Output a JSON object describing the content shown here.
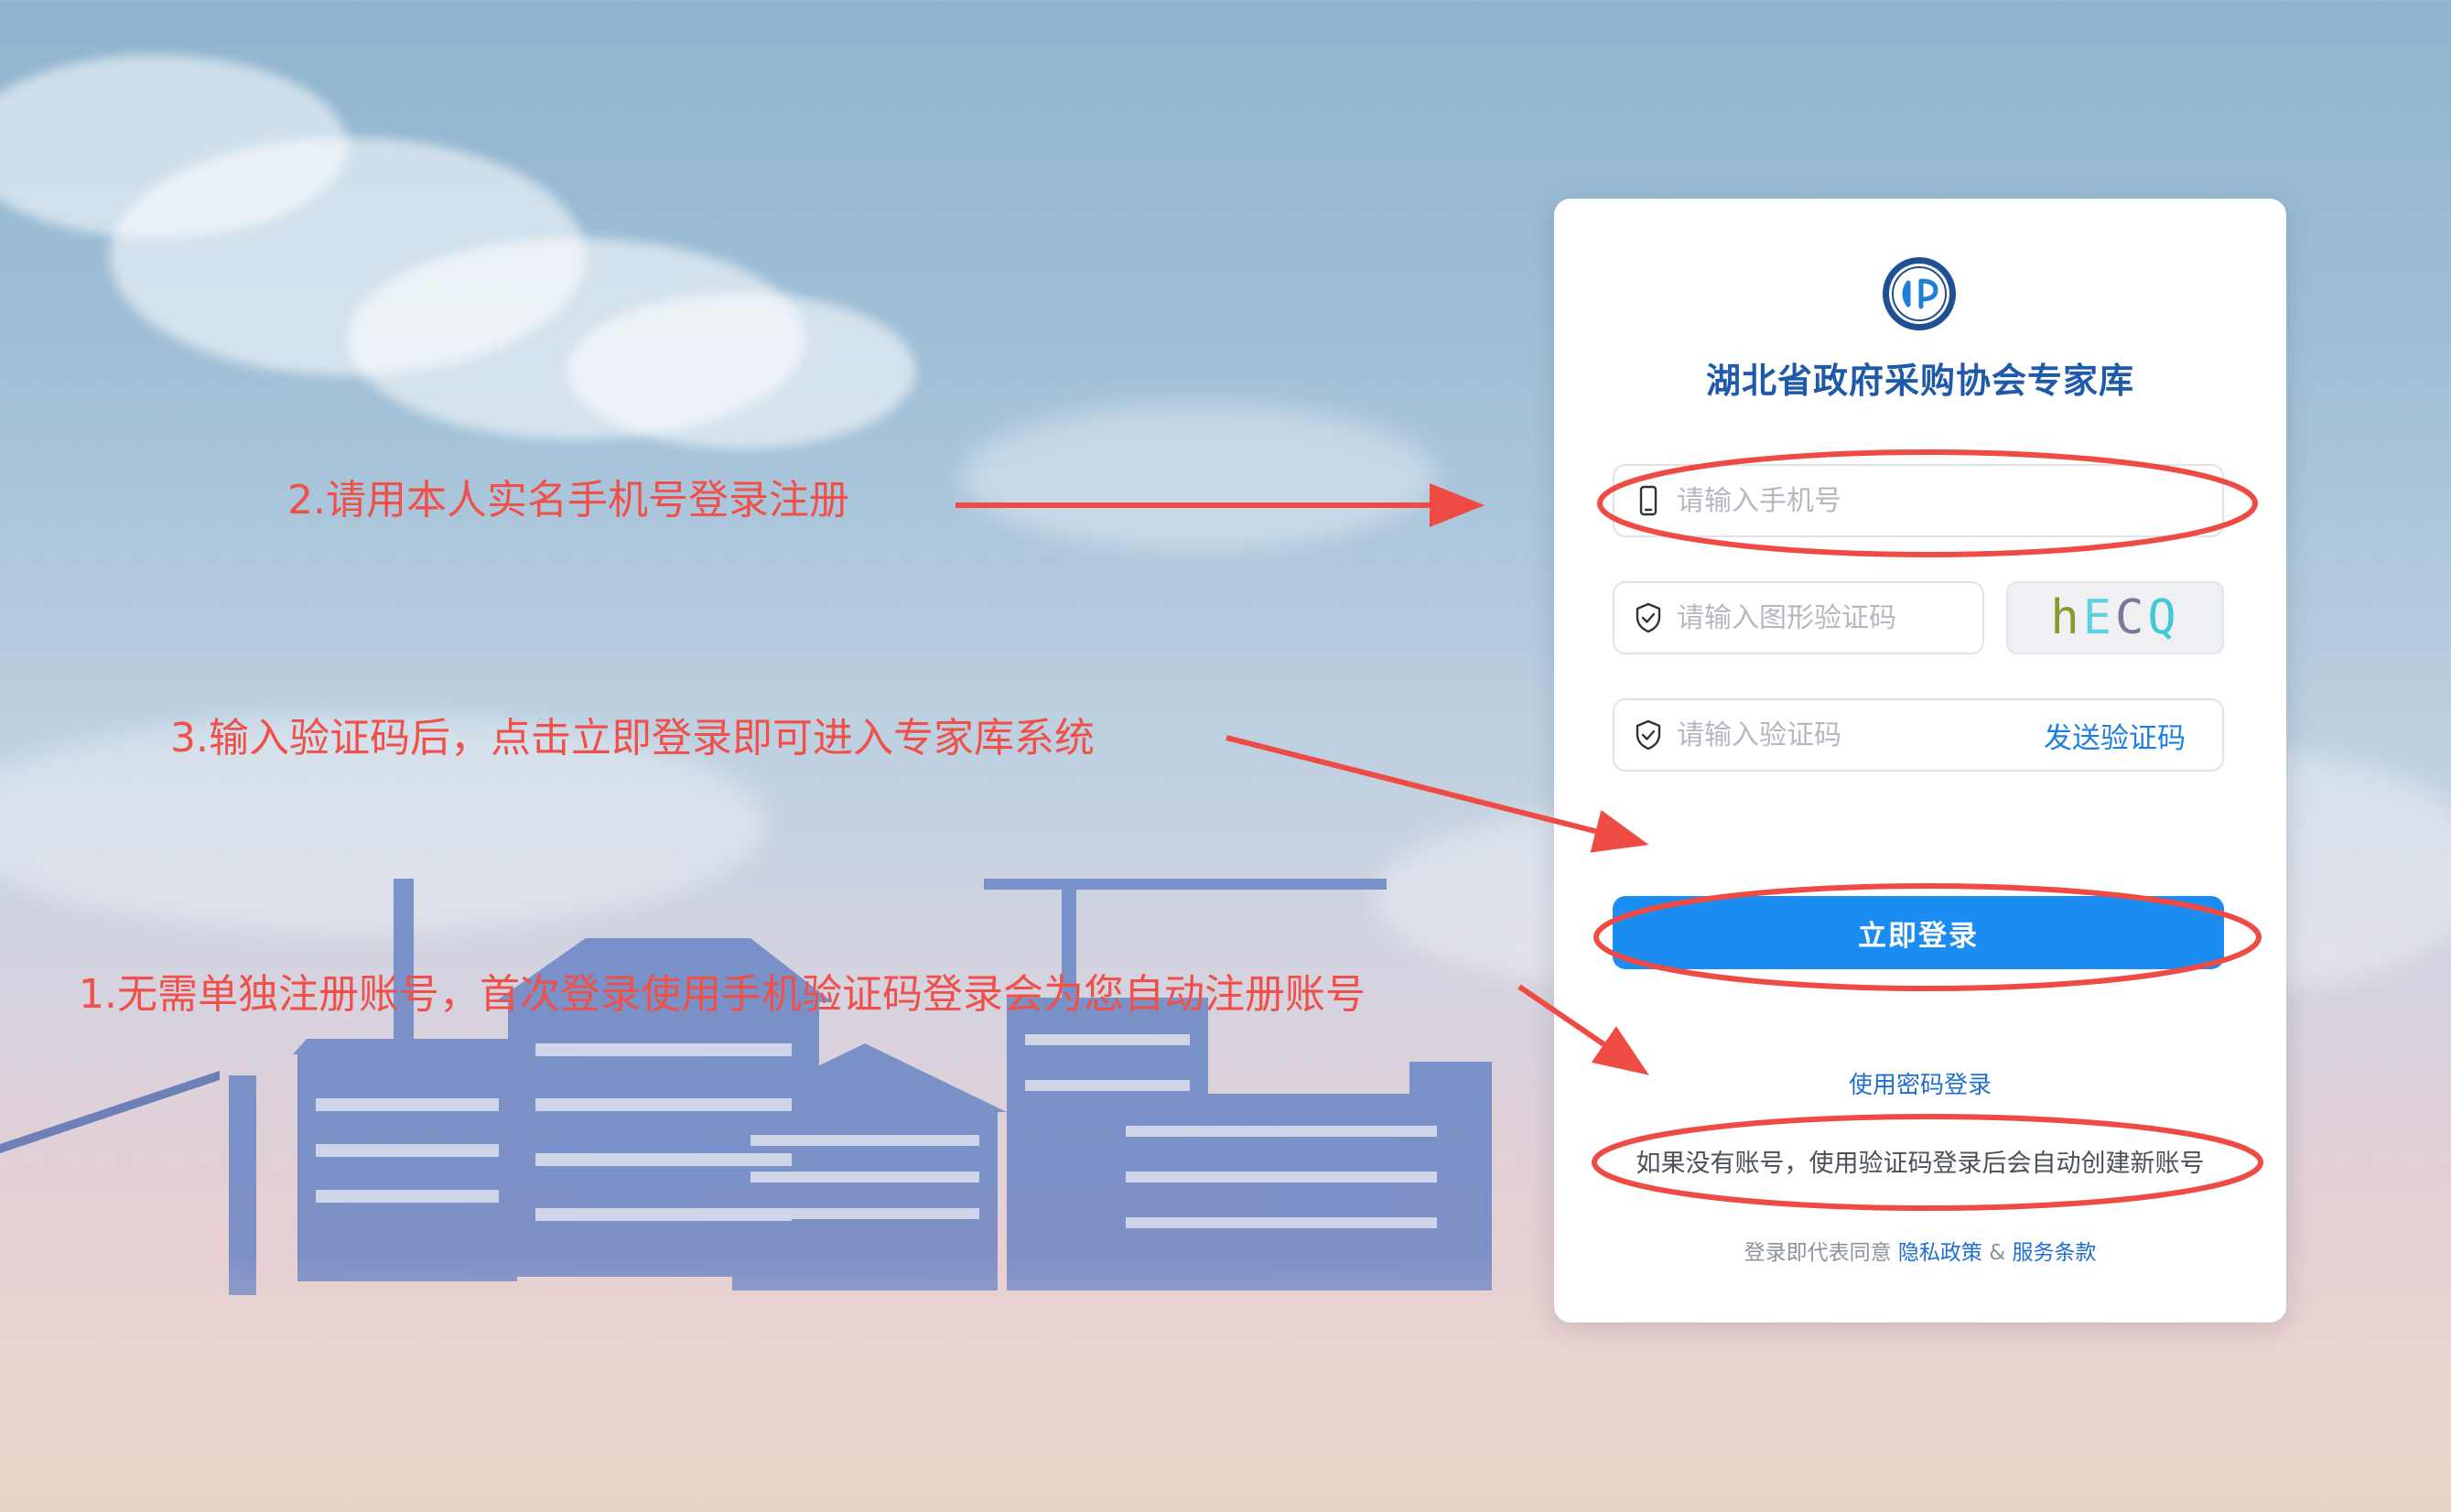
{
  "org_title": "湖北省政府采购协会专家库",
  "form": {
    "phone_placeholder": "请输入手机号",
    "captcha_placeholder": "请输入图形验证码",
    "captcha_chars": [
      "h",
      "E",
      "C",
      "Q"
    ],
    "sms_placeholder": "请输入验证码",
    "send_code_label": "发送验证码",
    "login_label": "立即登录",
    "password_login_label": "使用密码登录",
    "auto_create_hint": "如果没有账号，使用验证码登录后会自动创建新账号",
    "agree_prefix": "登录即代表同意",
    "privacy_label": "隐私政策",
    "amp": "&",
    "terms_label": "服务条款"
  },
  "annotations": {
    "step2": "2.请用本人实名手机号登录注册",
    "step3": "3.输入验证码后，点击立即登录即可进入专家库系统",
    "step1": "1.无需单独注册账号，首次登录使用手机验证码登录会为您自动注册账号"
  },
  "colors": {
    "brand_blue": "#1a8cf2",
    "title_blue": "#1e5aa8",
    "annotation_red": "#f0504a"
  },
  "icons": {
    "logo": "association-logo",
    "phone": "phone-icon",
    "shield": "shield-check-icon"
  }
}
